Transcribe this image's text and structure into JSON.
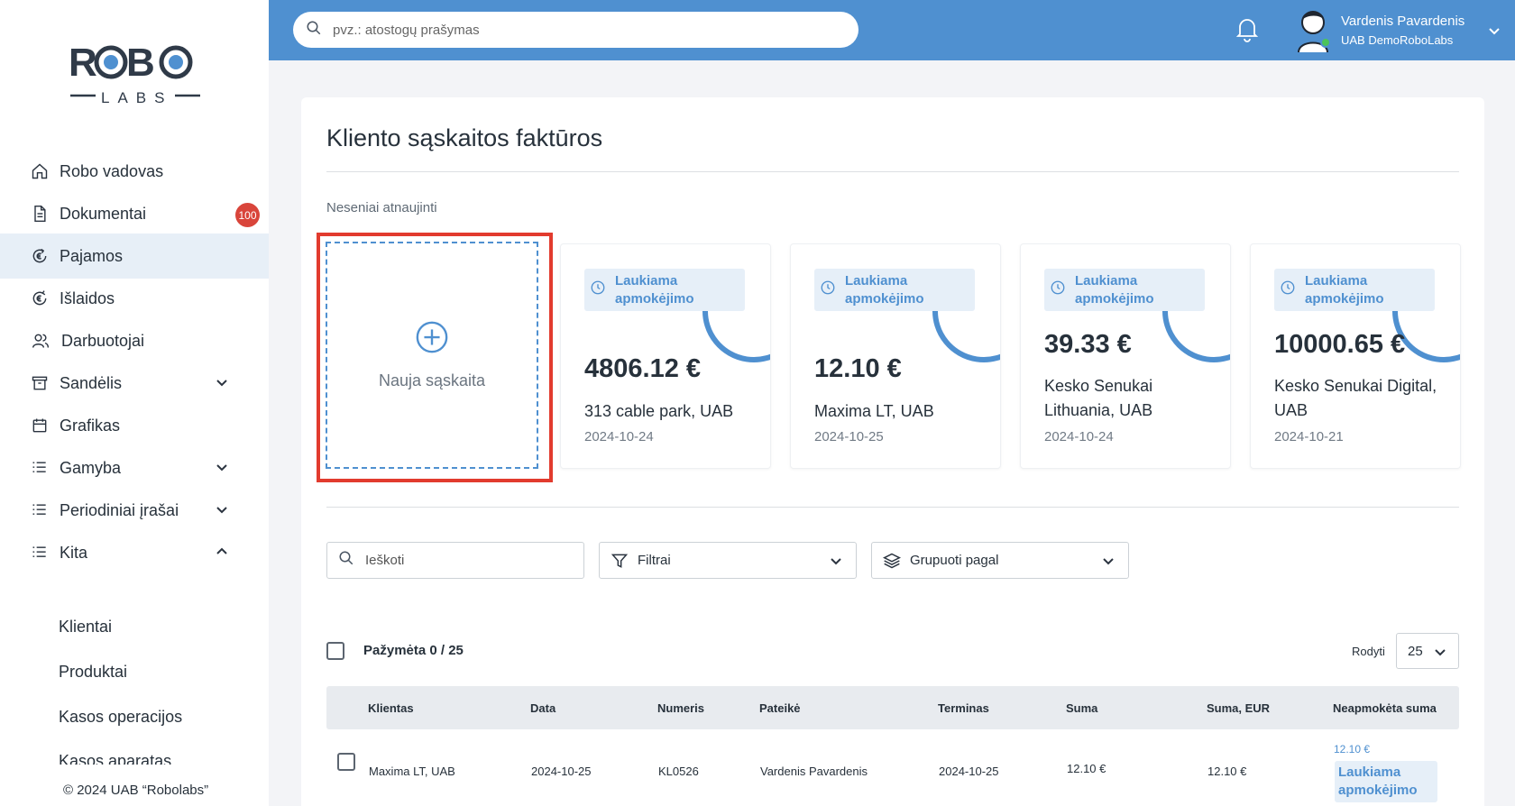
{
  "brand": {
    "logo_text_top": "ROBO",
    "logo_text_bottom": "LABS"
  },
  "sidebar": {
    "items": [
      {
        "label": "Robo vadovas",
        "icon": "home-icon"
      },
      {
        "label": "Dokumentai",
        "icon": "document-icon",
        "badge": "100"
      },
      {
        "label": "Pajamos",
        "icon": "income-icon",
        "active": true
      },
      {
        "label": "Išlaidos",
        "icon": "expenses-icon"
      },
      {
        "label": "Darbuotojai",
        "icon": "users-icon"
      },
      {
        "label": "Sandėlis",
        "icon": "archive-icon",
        "expandable": true
      },
      {
        "label": "Grafikas",
        "icon": "calendar-icon"
      },
      {
        "label": "Gamyba",
        "icon": "list-icon",
        "expandable": true
      },
      {
        "label": "Periodiniai įrašai",
        "icon": "list-icon",
        "expandable": true
      },
      {
        "label": "Kita",
        "icon": "list-icon",
        "expanded": true
      }
    ],
    "subitems": [
      "Klientai",
      "Produktai",
      "Kasos operacijos",
      "Kasos aparatas"
    ],
    "copyright": "© 2024 UAB “Robolabs”"
  },
  "topbar": {
    "search_placeholder": "pvz.: atostogų prašymas",
    "user_name": "Vardenis Pavardenis",
    "user_company": "UAB DemoRoboLabs"
  },
  "main": {
    "title": "Kliento sąskaitos faktūros",
    "recent_label": "Neseniai atnaujinti",
    "new_invoice_label": "Nauja sąskaita",
    "cards": [
      {
        "status": "Laukiama apmokėjimo",
        "amount": "4806.12 €",
        "client": "313 cable park, UAB",
        "date": "2024-10-24"
      },
      {
        "status": "Laukiama apmokėjimo",
        "amount": "12.10 €",
        "client": "Maxima LT, UAB",
        "date": "2024-10-25"
      },
      {
        "status": "Laukiama apmokėjimo",
        "amount": "39.33 €",
        "client": "Kesko Senukai Lithuania, UAB",
        "date": "2024-10-24"
      },
      {
        "status": "Laukiama apmokėjimo",
        "amount": "10000.65 €",
        "client": "Kesko Senukai Digital, UAB",
        "date": "2024-10-21"
      }
    ],
    "search_placeholder": "Ieškoti",
    "filters_label": "Filtrai",
    "group_by_label": "Grupuoti pagal",
    "selected_label": "Pažymėta 0 / 25",
    "show_label": "Rodyti",
    "page_size": "25"
  },
  "table": {
    "columns": [
      "Klientas",
      "Data",
      "Numeris",
      "Pateikė",
      "Terminas",
      "Suma",
      "Suma, EUR",
      "Neapmokėta suma"
    ],
    "rows": [
      {
        "client": "Maxima LT, UAB",
        "date": "2024-10-25",
        "number": "KL0526",
        "submitted_by": "Vardenis Pavardenis",
        "due": "2024-10-25",
        "amount": "12.10 €",
        "amount_eur": "12.10 €",
        "unpaid": "12.10 €",
        "status": "Laukiama apmokėjimo"
      }
    ]
  },
  "colors": {
    "accent": "#4f90d0",
    "badge": "#d9453b",
    "highlight": "#e23b2e",
    "status_bg": "#e6eff8"
  }
}
